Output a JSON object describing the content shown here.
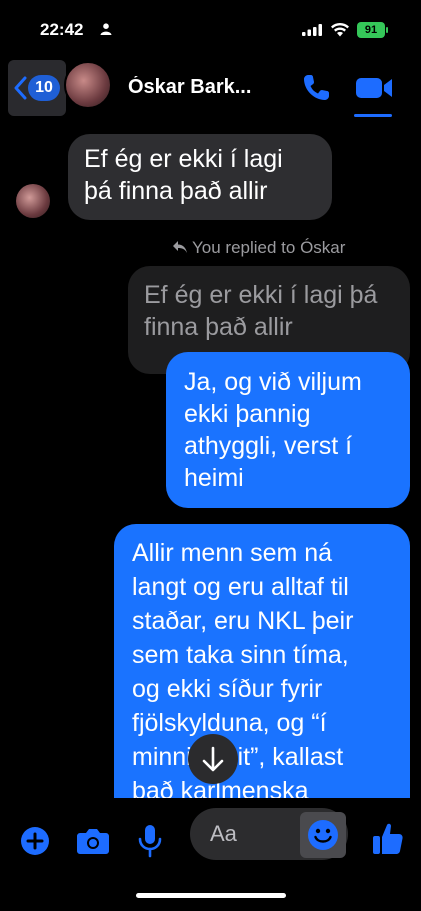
{
  "status_bar": {
    "time": "22:42",
    "battery": "91",
    "icons": [
      "person-icon",
      "signal-icon",
      "wifi-icon",
      "battery-icon"
    ]
  },
  "header": {
    "back_badge": "10",
    "contact_name": "Óskar Bark...",
    "icons": [
      "chevron-left-icon",
      "phone-icon",
      "video-camera-icon"
    ]
  },
  "messages": [
    {
      "type": "incoming",
      "lines": [
        "Ef ég er ekki í lagi",
        "þá finna það allir"
      ]
    },
    {
      "type": "reply_note",
      "text": "You replied to Óskar"
    },
    {
      "type": "quoted",
      "lines": [
        "Ef ég er ekki í lagi þá",
        "finna það allir"
      ]
    },
    {
      "type": "outgoing",
      "lines": [
        "Ja, og við viljum",
        "ekki þannig",
        "athyggli, verst í",
        "heimi"
      ]
    },
    {
      "type": "outgoing",
      "lines": [
        "Allir menn sem ná",
        "langt og eru alltaf til",
        "staðar, eru NKL þeir",
        "sem taka sinn tíma,",
        "og ekki síður fyrir",
        "fjölskylduna, og “í",
        "minni sveit”, kallast",
        "það karlmenska"
      ]
    }
  ],
  "composer": {
    "placeholder": "Aa",
    "icons": [
      "plus-icon",
      "camera-icon",
      "microphone-icon",
      "emoji-icon",
      "thumbs-up-icon"
    ]
  },
  "colors": {
    "outgoing_bubble": "#1a73ff",
    "incoming_bubble": "#2e2e31",
    "accent": "#1d6cff",
    "battery": "#35c759"
  }
}
